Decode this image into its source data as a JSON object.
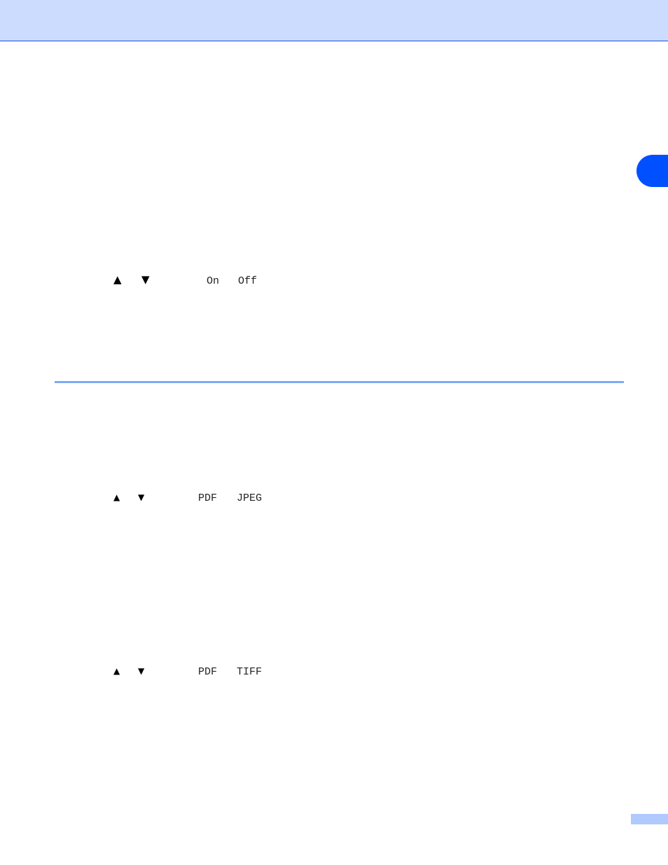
{
  "header": {
    "band_color": "#ccdcff",
    "rule_color": "#1a4fd8"
  },
  "chapter_tab": {
    "color": "#0050ff"
  },
  "section_rule": {
    "color": "#7fa9f7"
  },
  "page_tag": {
    "color": "#b0c9ff"
  },
  "lines": [
    {
      "up_icon": "▲",
      "down_icon": "▼",
      "option_a": "On",
      "option_b": "Off"
    },
    {
      "up_icon": "▲",
      "down_icon": "▼",
      "option_a": "PDF",
      "option_b": "JPEG"
    },
    {
      "up_icon": "▲",
      "down_icon": "▼",
      "option_a": "PDF",
      "option_b": "TIFF"
    }
  ]
}
